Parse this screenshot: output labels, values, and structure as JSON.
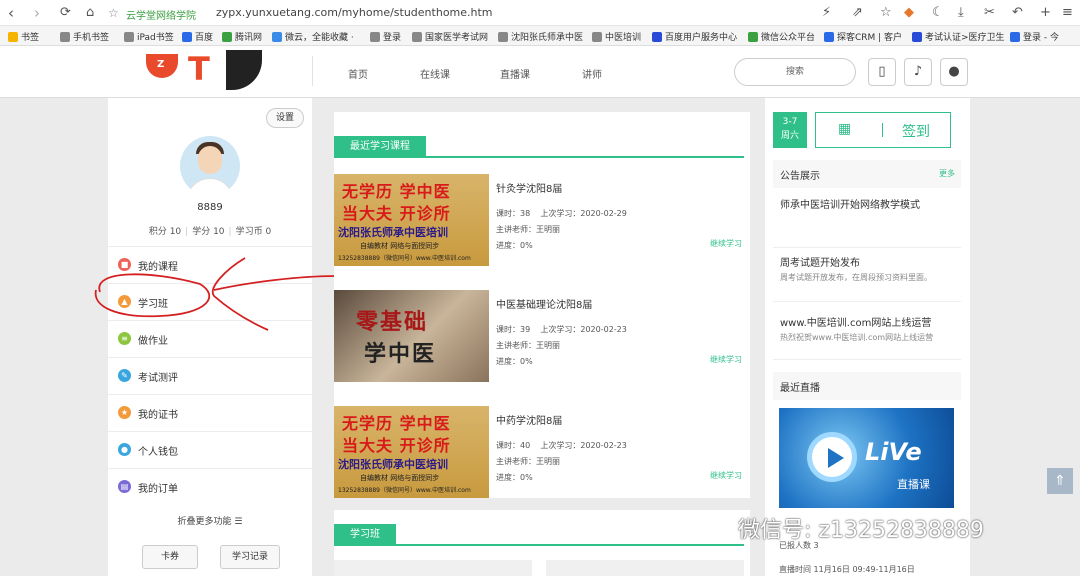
{
  "browser": {
    "site_name": "云学堂网络学院",
    "url": "zypx.yunxuetang.com/myhome/studenthome.htm",
    "bookmarks": [
      "书签",
      "手机书签",
      "iPad书签",
      "百度",
      "腾讯网",
      "微云，全能收藏 ·",
      "登录",
      "国家医学考试网",
      "沈阳张氏师承中医",
      "中医培训",
      "百度用户服务中心",
      "微信公众平台",
      "探客CRM | 客户",
      "考试认证>医疗卫生",
      "登录 - 今"
    ],
    "nav_icons": [
      "back-icon",
      "forward-icon",
      "reload-icon",
      "home-icon",
      "star-icon"
    ]
  },
  "header": {
    "nav": [
      "首页",
      "在线课",
      "直播课",
      "讲师"
    ],
    "search_placeholder": "搜索"
  },
  "profile": {
    "settings_label": "设置",
    "username": "8889",
    "stats": [
      "积分 10",
      "学分 10",
      "学习币 0"
    ]
  },
  "menu": [
    {
      "label": "我的课程",
      "color": "#f0605a"
    },
    {
      "label": "学习班",
      "color": "#f39a3a"
    },
    {
      "label": "做作业",
      "color": "#8cc63f"
    },
    {
      "label": "考试测评",
      "color": "#3aa6e0"
    },
    {
      "label": "我的证书",
      "color": "#f39a3a"
    },
    {
      "label": "个人钱包",
      "color": "#3aa6e0"
    },
    {
      "label": "我的订单",
      "color": "#7a6ad8"
    }
  ],
  "sidebar_footer": {
    "fold_more": "折叠更多功能 ☰",
    "coupon": "卡券",
    "study_record": "学习记录"
  },
  "recent": {
    "section_title": "最近学习课程",
    "continue_label": "继续学习",
    "courses": [
      {
        "title": "针灸学沈阳8届",
        "hours": "课时：38",
        "last_study": "上次学习：2020-02-29",
        "teacher": "主讲老师：王明丽",
        "progress": "进度：0%",
        "thumb": [
          "无学历 学中医",
          "当大夫 开诊所",
          "沈阳张氏师承中医培训",
          "自编教材  网络与面授同步",
          "13252838889（微信同号）www.中医培训.com"
        ]
      },
      {
        "title": "中医基础理论沈阳8届",
        "hours": "课时：39",
        "last_study": "上次学习：2020-02-23",
        "teacher": "主讲老师：王明丽",
        "progress": "进度：0%",
        "thumb": [
          "零基础",
          "学中医"
        ]
      },
      {
        "title": "中药学沈阳8届",
        "hours": "课时：40",
        "last_study": "上次学习：2020-02-23",
        "teacher": "主讲老师：王明丽",
        "progress": "进度：0%",
        "thumb": [
          "无学历 学中医",
          "当大夫 开诊所",
          "沈阳张氏师承中医培训",
          "自编教材  网络与面授同步",
          "13252838889（微信同号）www.中医培训.com"
        ]
      }
    ]
  },
  "study_class": {
    "section_title": "学习班"
  },
  "right": {
    "date": "3-7",
    "weekday": "周六",
    "signin": "签到",
    "notice_title": "公告展示",
    "more": "更多",
    "notices": [
      {
        "title": "师承中医培训开始网络教学模式",
        "desc": ""
      },
      {
        "title": "周考试题开始发布",
        "desc": "周考试题开放发布，在周段预习资料里面。"
      },
      {
        "title": "www.中医培训.com网站上线运营",
        "desc": "热烈祝贺www.中医培训.com网站上线运营"
      }
    ],
    "live_title": "最近直播",
    "live_logo": "LiVe",
    "live_sub": "直播课",
    "live_count": "已报人数  3",
    "live_time": "直播时间  11月16日 09:49-11月16日"
  },
  "watermark": "微信号: z13252838889"
}
